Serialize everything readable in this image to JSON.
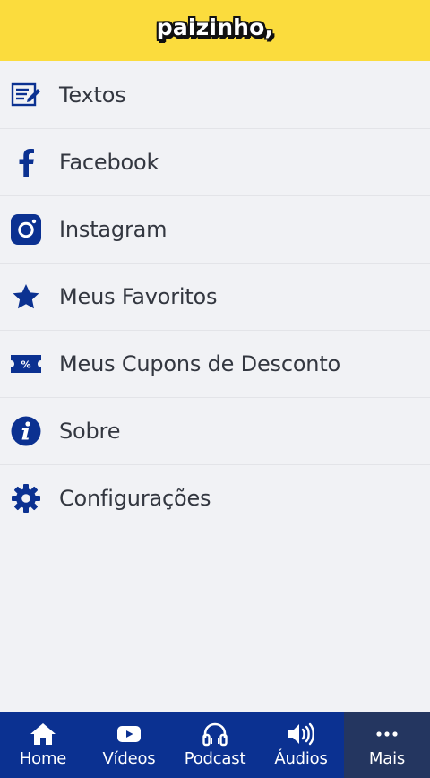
{
  "header": {
    "logo_text": "paizinho,",
    "bg_color": "#fbdc3d"
  },
  "menu": {
    "items": [
      {
        "label": "Textos",
        "icon": "document-edit-icon"
      },
      {
        "label": "Facebook",
        "icon": "facebook-icon"
      },
      {
        "label": "Instagram",
        "icon": "instagram-icon"
      },
      {
        "label": "Meus Favoritos",
        "icon": "star-icon"
      },
      {
        "label": "Meus Cupons de Desconto",
        "icon": "coupon-icon"
      },
      {
        "label": "Sobre",
        "icon": "info-icon"
      },
      {
        "label": "Configurações",
        "icon": "gear-icon"
      }
    ],
    "icon_color": "#0b3191"
  },
  "tabbar": {
    "bg_color": "#0b3191",
    "active_bg_color": "#243660",
    "tabs": [
      {
        "label": "Home",
        "icon": "home-icon"
      },
      {
        "label": "Vídeos",
        "icon": "youtube-icon"
      },
      {
        "label": "Podcast",
        "icon": "headphones-icon"
      },
      {
        "label": "Áudios",
        "icon": "speaker-icon"
      },
      {
        "label": "Mais",
        "icon": "more-dots-icon",
        "active": true
      }
    ]
  }
}
